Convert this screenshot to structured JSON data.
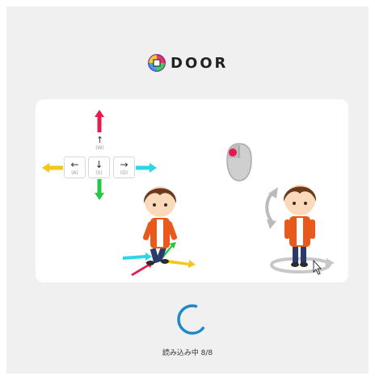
{
  "brand": {
    "name": "DOOR"
  },
  "controls": {
    "up_key": {
      "arrow": "↑",
      "letter": "(W)"
    },
    "left_key": {
      "arrow": "←",
      "letter": "(A)"
    },
    "down_key": {
      "arrow": "↓",
      "letter": "(S)"
    },
    "right_key": {
      "arrow": "→",
      "letter": "(D)"
    }
  },
  "loading": {
    "text": "読み込み中 8/8",
    "progress": 1.0
  },
  "colors": {
    "up_arrow": "#e8194f",
    "down_arrow": "#22c943",
    "left_arrow": "#f5c518",
    "right_arrow": "#2ad6e8",
    "spinner": "#1e88c9",
    "mouse_button": "#e8194f"
  }
}
